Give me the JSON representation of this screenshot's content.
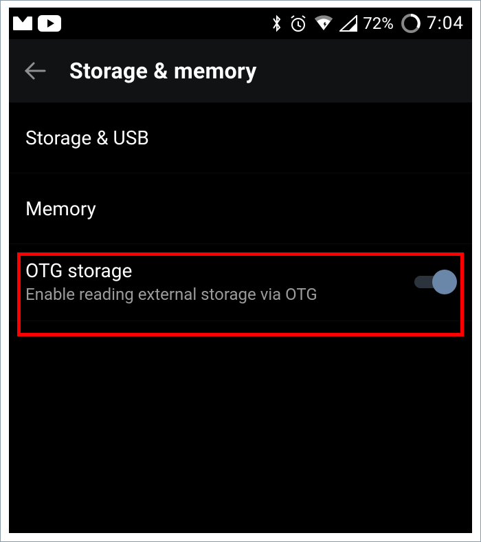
{
  "status": {
    "battery": "72%",
    "time": "7:04"
  },
  "header": {
    "title": "Storage & memory"
  },
  "items": [
    {
      "label": "Storage & USB"
    },
    {
      "label": "Memory"
    },
    {
      "label": "OTG storage",
      "sub": "Enable reading external storage via OTG",
      "toggle": true
    }
  ]
}
